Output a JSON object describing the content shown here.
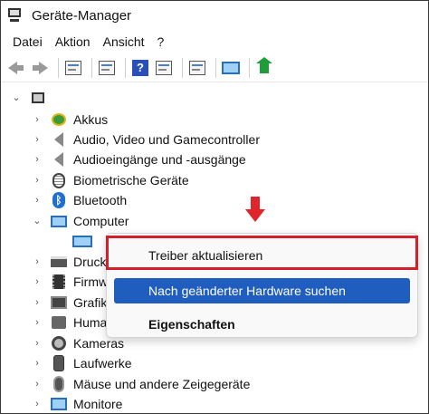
{
  "window": {
    "title": "Geräte-Manager"
  },
  "menubar": [
    "Datei",
    "Aktion",
    "Ansicht",
    "?"
  ],
  "toolbar": {
    "buttons": [
      "back-arrow-icon",
      "forward-arrow-icon",
      "properties-icon",
      "view-icon",
      "help-icon",
      "resources-icon",
      "update-driver-icon",
      "scan-hardware-icon",
      "add-driver-icon"
    ]
  },
  "tree": {
    "categories": [
      {
        "label": "Akkus",
        "icon": "battery-icon"
      },
      {
        "label": "Audio, Video und Gamecontroller",
        "icon": "speaker-icon"
      },
      {
        "label": "Audioeingänge und -ausgänge",
        "icon": "speaker-icon"
      },
      {
        "label": "Biometrische Geräte",
        "icon": "fingerprint-icon"
      },
      {
        "label": "Bluetooth",
        "icon": "bluetooth-icon"
      },
      {
        "label": "Computer",
        "icon": "computer-icon",
        "expanded": true
      },
      {
        "label": "Druck",
        "icon": "printer-icon"
      },
      {
        "label": "Firmw",
        "icon": "firmware-icon"
      },
      {
        "label": "Grafik",
        "icon": "graphics-icon"
      },
      {
        "label": "Huma",
        "icon": "hid-icon"
      },
      {
        "label": "Kameras",
        "icon": "camera-icon"
      },
      {
        "label": "Laufwerke",
        "icon": "disk-icon"
      },
      {
        "label": "Mäuse und andere Zeigegeräte",
        "icon": "mouse-icon"
      },
      {
        "label": "Monitore",
        "icon": "monitor-icon"
      }
    ]
  },
  "context_menu": {
    "items": [
      {
        "label": "Treiber aktualisieren",
        "selected": false,
        "bold": false
      },
      {
        "label": "Nach geänderter Hardware suchen",
        "selected": true,
        "bold": false
      },
      {
        "label": "Eigenschaften",
        "selected": false,
        "bold": true
      }
    ]
  },
  "colors": {
    "highlight_red": "#d4202a",
    "selection_blue": "#1f5dbf"
  }
}
